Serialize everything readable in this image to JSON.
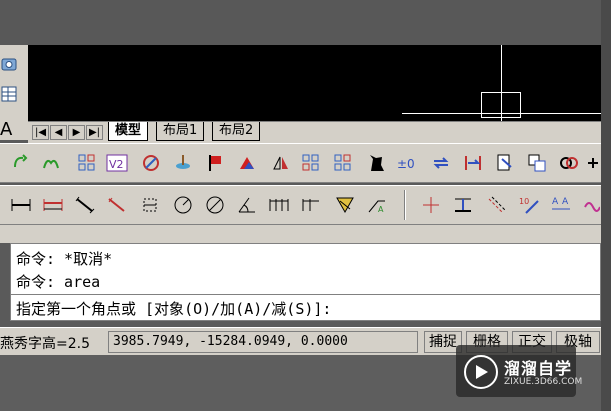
{
  "left_panel": {
    "label": "A"
  },
  "layout_tabs": {
    "nav": [
      "|◀",
      "◀",
      "▶",
      "▶|"
    ],
    "tabs": [
      {
        "label": "模型",
        "active": true
      },
      {
        "label": "布局1",
        "active": false
      },
      {
        "label": "布局2",
        "active": false
      }
    ]
  },
  "toolbar1": {
    "icons": [
      "rotate-icon",
      "mirror-arc-icon",
      "array-icon",
      "v2-icon",
      "paint-icon",
      "layer-icon",
      "flag-icon",
      "highlight-icon",
      "mirror-icon",
      "grid-icon",
      "grid-icon",
      "cat-icon",
      "zero-icon",
      "swap-icon",
      "stretch-icon",
      "page-icon",
      "copy-icon",
      "link-icon",
      "more-icon"
    ],
    "labels": {
      "zero": "±0",
      "v2": "V2"
    }
  },
  "toolbar2": {
    "icons": [
      "dim-linear-icon",
      "dim-aligned-icon",
      "dim-diag-icon",
      "dim-rotated-icon",
      "dim-ordinate-icon",
      "dim-radius-icon",
      "dim-diameter-icon",
      "dim-angle-icon",
      "dim-baseline-icon",
      "dim-continue-icon",
      "dim-tolerance-icon",
      "dim-leader-icon",
      "center-mark-icon",
      "tolerance-icon",
      "oblique-icon",
      "text-number-icon",
      "text-scale-icon",
      "wave-icon"
    ],
    "labels": {
      "ten": "10"
    }
  },
  "command": {
    "lines": [
      "命令: *取消*",
      "命令: area"
    ],
    "prompt": "指定第一个角点或 [对象(O)/加(A)/减(S)]:"
  },
  "status": {
    "font_height": "燕秀字高=2.5",
    "coords": "3985.7949,  -15284.0949, 0.0000",
    "buttons": [
      "捕捉",
      "栅格",
      "正交",
      "极轴"
    ]
  },
  "watermark": {
    "name": "溜溜自学",
    "url": "ZIXUE.3D66.COM"
  }
}
